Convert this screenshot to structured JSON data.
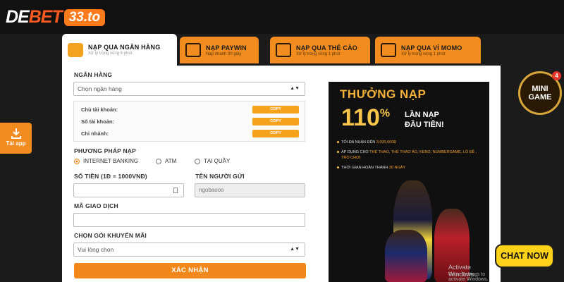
{
  "brand": {
    "name_white": "DE",
    "name_red": "BET",
    "badge": "33.to"
  },
  "side_download": {
    "label": "Tải app",
    "icon": "download-icon"
  },
  "tabs": [
    {
      "title": "NẠP QUA NGÂN HÀNG",
      "sub": "Xử lý trong vòng 5 phút",
      "icon": "bank-icon"
    },
    {
      "title": "NẠP PAYWIN",
      "sub": "Nạp nhanh 30 giây",
      "icon": "phone-icon"
    },
    {
      "title": "NẠP QUA THẺ CÀO",
      "sub": "Xử lý trong vòng 1 phút",
      "icon": "card-icon"
    },
    {
      "title": "NẠP QUA VÍ MOMO",
      "sub": "Xử lý trong vòng 1 phút",
      "icon": "momo-icon"
    }
  ],
  "form": {
    "bank_label": "NGÂN HÀNG",
    "bank_select": "Chọn ngân hàng",
    "info_rows": [
      {
        "label": "Chủ tài khoản:",
        "button": "COPY"
      },
      {
        "label": "Số tài khoản:",
        "button": "COPY"
      },
      {
        "label": "Chi nhánh:",
        "button": "COPY"
      }
    ],
    "method_label": "PHƯƠNG PHÁP NẠP",
    "methods": [
      "INTERNET BANKING",
      "ATM",
      "TẠI QUẦY"
    ],
    "amount_label": "SỐ TIỀN (1Đ = 1000VNĐ)",
    "sender_label": "TÊN NGƯỜI GỬI",
    "sender_value": "ngobaooo",
    "txn_label": "MÃ GIAO DỊCH",
    "promo_label": "CHỌN GÓI KHUYẾN MÃI",
    "promo_select": "Vui lòng chọn",
    "submit": "XÁC NHẬN"
  },
  "promo": {
    "title": "THƯỞNG NẠP",
    "percent": "110",
    "percent_sign": "%",
    "line1": "LẦN NẠP",
    "line2": "ĐẦU TIÊN!",
    "bullets": [
      {
        "text": "TỐI ĐA NHẬN ĐẾN ",
        "hl": "3,000,000Đ"
      },
      {
        "text": "ÁP DỤNG CHO ",
        "hl": "THỂ THAO, THỂ THAO ẢO, KENO, NUMBERGAME, LÔ ĐỀ , TRÒ CHƠI"
      },
      {
        "text": "THỜI GIAN HOÀN THÀNH ",
        "hl": "30 NGÀY"
      }
    ],
    "watermark1": "Activate Windows",
    "watermark2": "Go to Settings to activate Windows."
  },
  "mini_game": {
    "line1": "MINI",
    "line2": "GAME",
    "badge": "4"
  },
  "chat": {
    "label": "CHAT NOW"
  },
  "colors": {
    "accent": "#f28c1e",
    "background": "#1b1b1b",
    "panel": "#ffffff",
    "gold": "#f6c54a"
  }
}
